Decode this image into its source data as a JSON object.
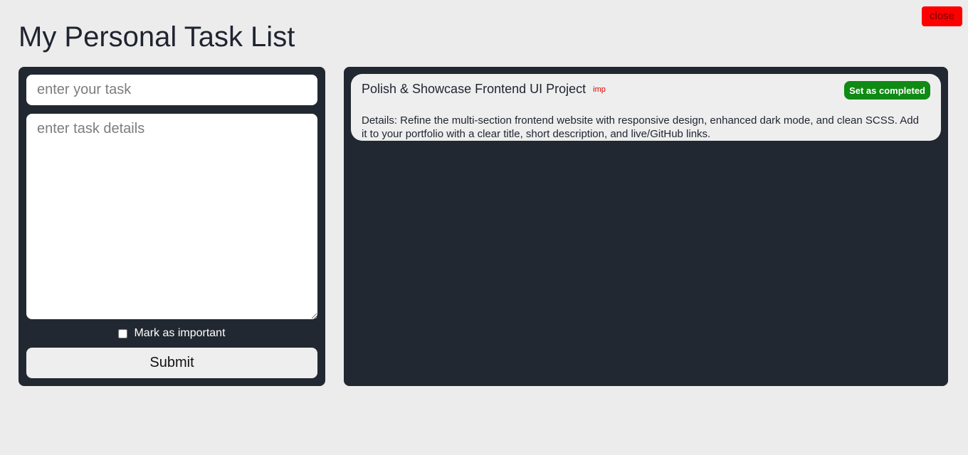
{
  "header": {
    "title": "My Personal Task List",
    "close_label": "close"
  },
  "form": {
    "task_placeholder": "enter your task",
    "details_placeholder": "enter task details",
    "important_label": "Mark as important",
    "important_checked": false,
    "submit_label": "Submit"
  },
  "tasks": [
    {
      "title": "Polish & Showcase Frontend UI Project",
      "tag": "imp",
      "action_label": "Set as completed",
      "details": "Details: Refine the multi-section frontend website with responsive design, enhanced dark mode, and clean SCSS. Add it to your portfolio with a clear title, short description, and live/GitHub links."
    }
  ],
  "colors": {
    "background": "#ececec",
    "panel": "#222831",
    "close_button": "#ff0000",
    "complete_button": "#0f8a14",
    "important_tag": "#e00000"
  }
}
